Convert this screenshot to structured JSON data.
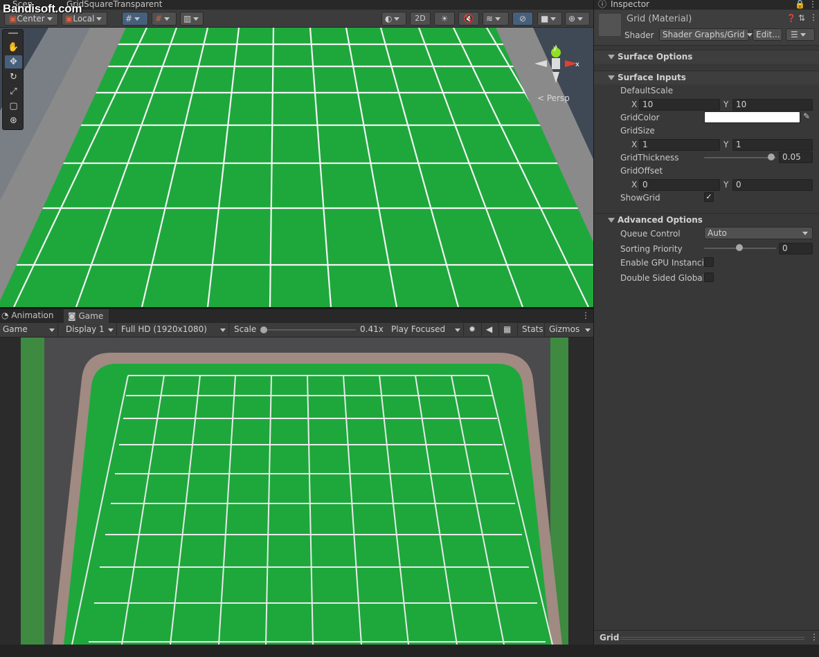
{
  "watermark": "Bandisoft.com",
  "scene_tabs": {
    "scene": "Scen",
    "prefab": "GridSquareTransparent"
  },
  "scene_toolbar": {
    "center": "Center",
    "local": "Local",
    "two_d": "2D"
  },
  "scene_view": {
    "persp_label": "< Persp",
    "axis_x": "x",
    "axis_y": "y"
  },
  "game_tabs": {
    "animation": "Animation",
    "game": "Game"
  },
  "game_toolbar": {
    "mode": "Game",
    "display": "Display 1",
    "resolution": "Full HD (1920x1080)",
    "scale_label": "Scale",
    "scale_value": "0.41x",
    "play_mode": "Play Focused",
    "stats": "Stats",
    "gizmos": "Gizmos"
  },
  "inspector": {
    "tab": "Inspector",
    "material_name": "Grid (Material)",
    "shader_label": "Shader",
    "shader_value": "Shader Graphs/Grid",
    "edit_button": "Edit...",
    "surface_options": "Surface Options",
    "surface_inputs": "Surface Inputs",
    "default_scale": {
      "label": "DefaultScale",
      "x_label": "X",
      "x": "10",
      "y_label": "Y",
      "y": "10"
    },
    "grid_color": {
      "label": "GridColor",
      "value": "#ffffff"
    },
    "grid_size": {
      "label": "GridSize",
      "x_label": "X",
      "x": "1",
      "y_label": "Y",
      "y": "1"
    },
    "grid_thickness": {
      "label": "GridThickness",
      "value": "0.05",
      "slider_fraction": 0.93
    },
    "grid_offset": {
      "label": "GridOffset",
      "x_label": "X",
      "x": "0",
      "y_label": "Y",
      "y": "0"
    },
    "show_grid": {
      "label": "ShowGrid",
      "checked": "✓"
    },
    "advanced_options": "Advanced Options",
    "queue_control": {
      "label": "Queue Control",
      "value": "Auto"
    },
    "sorting_priority": {
      "label": "Sorting Priority",
      "value": "0"
    },
    "enable_gpu": {
      "label": "Enable GPU Instancin"
    },
    "double_sided": {
      "label": "Double Sided Global I"
    },
    "footer": "Grid"
  },
  "colors": {
    "accent": "#46607c",
    "grid_green": "#1ea83c",
    "panel": "#383838"
  }
}
